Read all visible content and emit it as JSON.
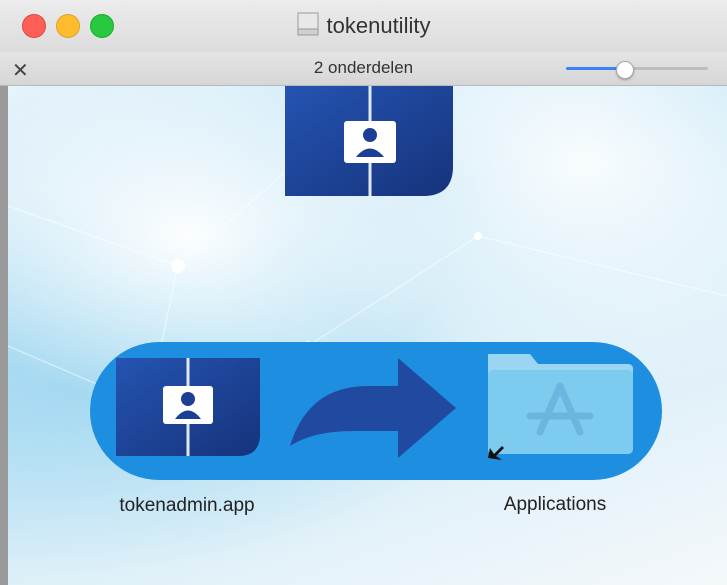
{
  "window": {
    "title": "tokenutility"
  },
  "toolbar": {
    "item_count": "2 onderdelen",
    "icon_size_level": 0.4
  },
  "items": {
    "app_label": "tokenadmin.app",
    "applications_label": "Applications"
  },
  "colors": {
    "pill_blue": "#1e8fe0",
    "icon_dark_blue": "#1c3f96",
    "arrow_blue": "#1f4aa0",
    "folder_blue": "#7ecbf0"
  }
}
